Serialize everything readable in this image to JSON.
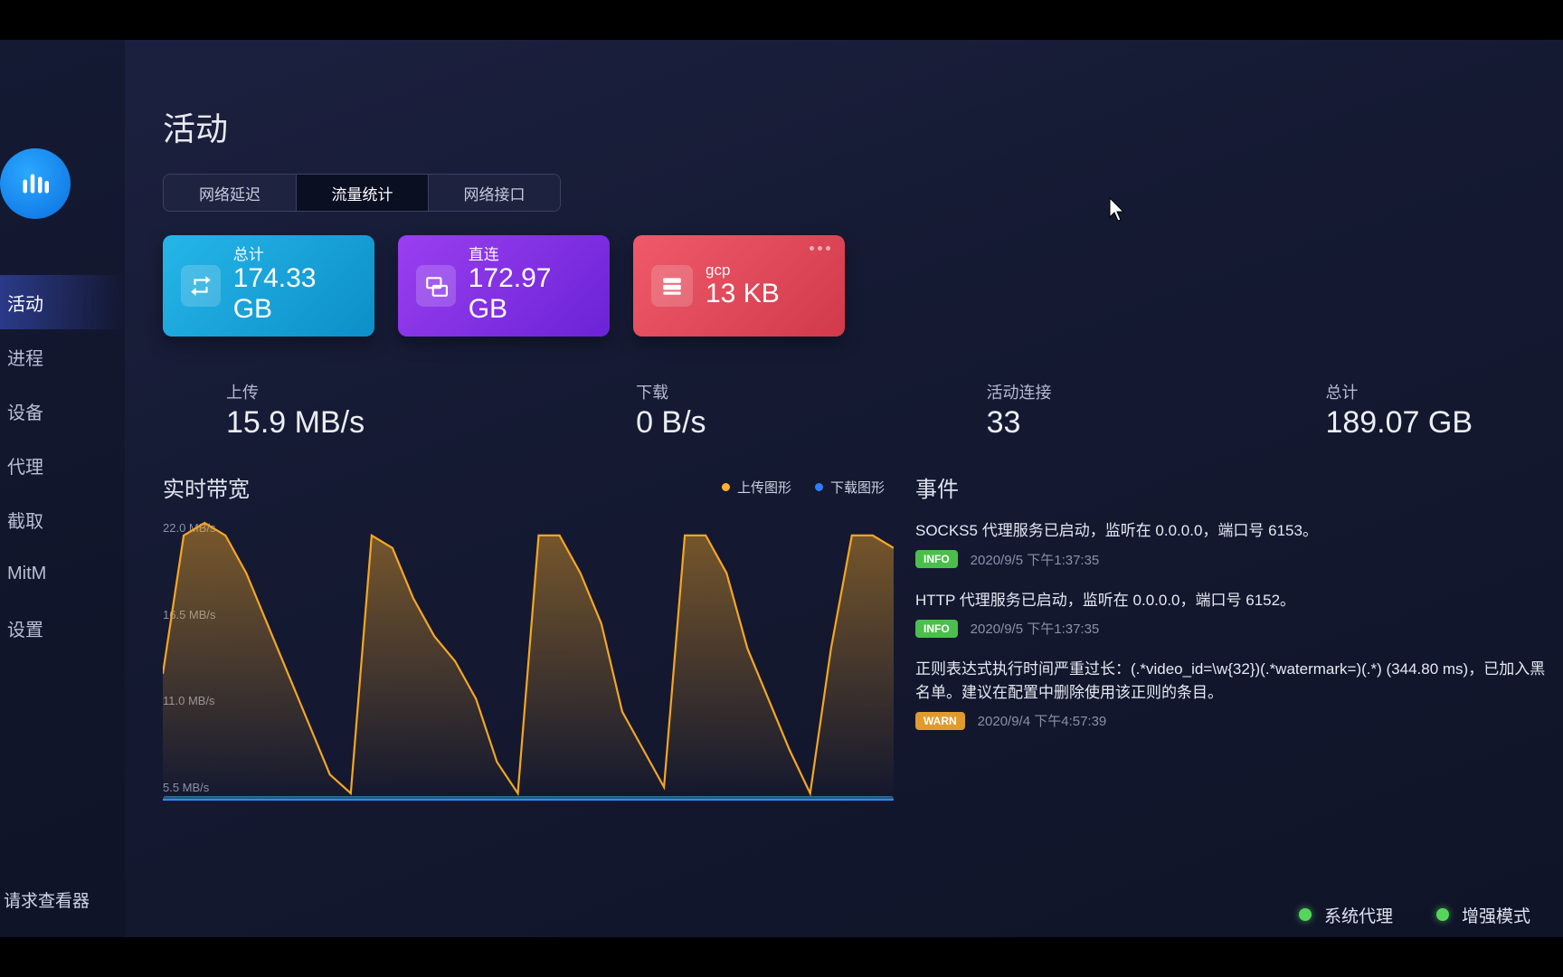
{
  "sidebar": {
    "items": [
      "活动",
      "进程",
      "设备",
      "代理",
      "截取",
      "MitM",
      "设置"
    ],
    "active_index": 0,
    "footer": "请求查看器"
  },
  "page_title": "活动",
  "tabs": {
    "items": [
      "网络延迟",
      "流量统计",
      "网络接口"
    ],
    "active_index": 1
  },
  "cards": [
    {
      "label": "总计",
      "value": "174.33 GB",
      "kind": "total"
    },
    {
      "label": "直连",
      "value": "172.97 GB",
      "kind": "direct"
    },
    {
      "label": "gcp",
      "value": "13 KB",
      "kind": "gcp",
      "menu": true
    }
  ],
  "stats": {
    "upload": {
      "label": "上传",
      "value": "15.9 MB/s"
    },
    "download": {
      "label": "下载",
      "value": "0 B/s"
    },
    "active": {
      "label": "活动连接",
      "value": "33"
    },
    "total": {
      "label": "总计",
      "value": "189.07 GB"
    }
  },
  "chart": {
    "title": "实时带宽",
    "legend_upload": "上传图形",
    "legend_download": "下载图形",
    "y_ticks": [
      "22.0 MB/s",
      "16.5 MB/s",
      "11.0 MB/s",
      "5.5 MB/s"
    ]
  },
  "events_title": "事件",
  "events": [
    {
      "msg": "SOCKS5 代理服务已启动，监听在 0.0.0.0，端口号 6153。",
      "level": "INFO",
      "time": "2020/9/5 下午1:37:35"
    },
    {
      "msg": "HTTP 代理服务已启动，监听在 0.0.0.0，端口号 6152。",
      "level": "INFO",
      "time": "2020/9/5 下午1:37:35"
    },
    {
      "msg": "正则表达式执行时间严重过长：(.*video_id=\\w{32})(.*watermark=)(.*) (344.80 ms)，已加入黑名单。建议在配置中删除使用该正则的条目。",
      "level": "WARN",
      "time": "2020/9/4 下午4:57:39"
    }
  ],
  "statusbar": {
    "system_proxy": "系统代理",
    "enhanced": "增强模式"
  },
  "chart_data": {
    "type": "line",
    "title": "实时带宽",
    "ylabel": "MB/s",
    "ylim": [
      0,
      22
    ],
    "y_ticks": [
      5.5,
      11.0,
      16.5,
      22.0
    ],
    "x": [
      0,
      1,
      2,
      3,
      4,
      5,
      6,
      7,
      8,
      9,
      10,
      11,
      12,
      13,
      14,
      15,
      16,
      17,
      18,
      19,
      20,
      21,
      22,
      23,
      24,
      25,
      26,
      27,
      28,
      29,
      30,
      31,
      32,
      33,
      34,
      35
    ],
    "series": [
      {
        "name": "上传图形",
        "color": "#f5a623",
        "values": [
          10,
          21,
          22,
          21,
          18,
          14,
          10,
          6,
          2,
          0.5,
          21,
          20,
          16,
          13,
          11,
          8,
          3,
          0.5,
          21,
          21,
          18,
          14,
          7,
          4,
          1,
          21,
          21,
          18,
          12,
          8,
          4,
          0.5,
          12,
          21,
          21,
          20
        ]
      },
      {
        "name": "下载图形",
        "color": "#2e7dff",
        "values": [
          0,
          0,
          0,
          0,
          0,
          0,
          0,
          0,
          0,
          0,
          0,
          0,
          0,
          0,
          0,
          0,
          0,
          0,
          0,
          0,
          0,
          0,
          0,
          0,
          0,
          0,
          0,
          0,
          0,
          0,
          0,
          0,
          0,
          0,
          0,
          0
        ]
      }
    ]
  }
}
